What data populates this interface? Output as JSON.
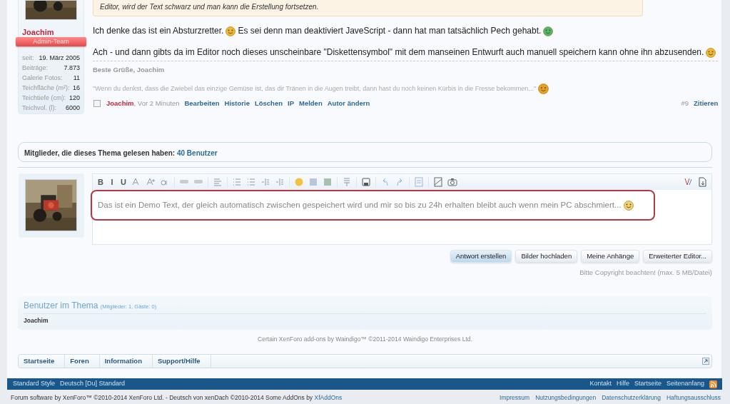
{
  "post": {
    "quote_box": {
      "text": "Editor, wird der Text schwarz und man kann die Erstellung fortsetzen."
    },
    "author": {
      "name": "Joachim",
      "role": "Admin-Team",
      "stats": [
        {
          "label": "seit:",
          "value": "19. März 2005"
        },
        {
          "label": "Beiträge:",
          "value": "7.873"
        },
        {
          "label": "Galerie Fotos:",
          "value": "11"
        },
        {
          "label": "Teichfläche (m²):",
          "value": "16"
        },
        {
          "label": "Teichtiefe (cm):",
          "value": "120"
        },
        {
          "label": "Teichvol. (l):",
          "value": "6000"
        }
      ]
    },
    "paragraphs": [
      [
        {
          "kind": "text",
          "text": "Ich denke das ist ein Absturzretter."
        },
        {
          "kind": "smiley",
          "color": "#f2b632"
        },
        {
          "kind": "text",
          "text": "Es sei denn man deaktiviert JaveScript - dann hat man tatsächlich Pech gehabt."
        },
        {
          "kind": "smiley",
          "color": "#4fb86a"
        }
      ],
      [
        {
          "kind": "text",
          "text": "Ach - und dann gibts da im Editor noch dieses unscheinbare \"Diskettensymbol\" mit dem manseinen Entwurft auch manuell speichern kann ohne ihn abzusenden."
        },
        {
          "kind": "smiley",
          "color": "#f2b632"
        }
      ]
    ],
    "signature": {
      "greeting": "Beste Grüße, Joachim",
      "quote": "\"Wenn du denkst, dass die Zwiebel das einzige Gemüse ist, das dir Tränen in die Augen treibt, dann hast du noch keinen Kürbis in die Fresse bekommen...\"",
      "quote_smiley": {
        "color": "#e8a020"
      }
    },
    "meta": {
      "checked": false,
      "author": "Joachim",
      "time": ", Vor 2 Minuten",
      "actions": [
        "Bearbeiten",
        "Historie",
        "Löschen",
        "IP",
        "Melden",
        "Autor ändern"
      ],
      "number": "#9",
      "quote_link": "Zitieren"
    }
  },
  "readers": {
    "label": "Mitglieder, die dieses Thema gelesen haben:",
    "link": "40 Benutzer"
  },
  "reply": {
    "toolbar_letters": [
      "B",
      "I",
      "U"
    ],
    "value": "Das ist ein Demo Text, der gleich automatisch zwischen gespeichert wird und mir so bis zu 24h erhalten bleibt auch wenn mein PC abschmiert...",
    "value_smiley": {
      "color": "#f0d070"
    },
    "buttons": [
      {
        "label": "Antwort erstellen",
        "primary": true
      },
      {
        "label": "Bilder hochladen",
        "primary": false
      },
      {
        "label": "Meine Anhänge",
        "primary": false
      },
      {
        "label": "Erweiterter Editor...",
        "primary": false
      }
    ],
    "note": "Bitte Copyright beachten! (max. 5 MB/Datei)"
  },
  "users_in_thread": {
    "title": "Benutzer im Thema",
    "subtitle": "(Mitglieder: 1, Gäste: 0)",
    "users": [
      "Joachim"
    ]
  },
  "credit": "Certain XenForo add-ons by Waindigo™ ©2011-2014 Waindigo Enterprises Ltd.",
  "breadcrumb": [
    "Startseite",
    "Foren",
    "Information",
    "Support/Hilfe"
  ],
  "footer": {
    "left": [
      "Standard Style",
      "Deutsch [Du] Standard"
    ],
    "right": [
      "Kontakt",
      "Hilfe",
      "Startseite",
      "Seitenanfang"
    ],
    "copyright": "Forum software by XenForo™ ©2010-2014 XenForo Ltd. - Deutsch von xenDach ©2010-2014 Some AddOns by",
    "copyright_link": "XfAddOns",
    "links": [
      "Impressum",
      "Nutzungsbedingungen",
      "Datenschutzerklärung",
      "Haftungsausschluss"
    ]
  }
}
